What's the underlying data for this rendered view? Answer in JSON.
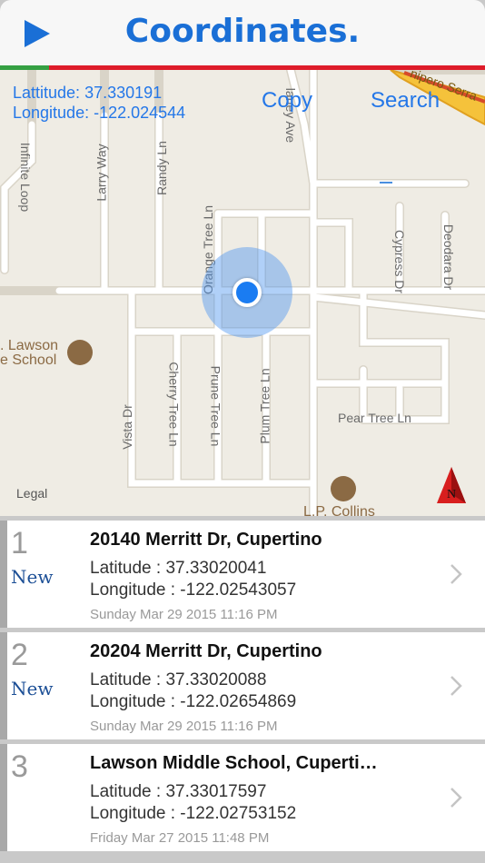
{
  "header": {
    "title": "Coordinates.",
    "play_icon": "play-icon",
    "accent_color": "#1a6fd6"
  },
  "map": {
    "coords": {
      "latitude_label": "Lattitude:",
      "latitude_value": "37.330191",
      "longitude_label": "Longitude:",
      "longitude_value": "-122.024544"
    },
    "copy_label": "Copy",
    "search_label": "Search",
    "legal_label": "Legal",
    "street_labels": {
      "infinite_loop": "Infinite Loop",
      "larry_way": "Larry Way",
      "randy_ln": "Randy Ln",
      "orange_tree_ln": "Orange Tree Ln",
      "cherry_tree_ln": "Cherry Tree Ln",
      "prune_tree_ln": "Prune Tree Ln",
      "plum_tree_ln": "Plum Tree Ln",
      "vista_dr": "Vista Dr",
      "cypress_dr": "Cypress Dr",
      "deodara_dr": "Deodara Dr",
      "pear_tree_ln": "Pear Tree Ln",
      "blaney_ave": "laney Ave",
      "junipero_serra": "nipero Serra",
      "infinite_loop_top": "Infinite Loo"
    },
    "poi_labels": {
      "lawson_line1": ". Lawson",
      "lawson_line2": "e School",
      "collins": "L.P. Collins"
    },
    "compass_label": "N"
  },
  "history": [
    {
      "index": "1",
      "badge": "New",
      "place": "20140 Merritt Dr, Cupertino",
      "latitude": "Latitude : 37.33020041",
      "longitude": "Longitude : -122.02543057",
      "timestamp": "Sunday Mar 29 2015 11:16 PM"
    },
    {
      "index": "2",
      "badge": "New",
      "place": "20204 Merritt Dr, Cupertino",
      "latitude": "Latitude : 37.33020088",
      "longitude": "Longitude : -122.02654869",
      "timestamp": "Sunday Mar 29 2015 11:16 PM"
    },
    {
      "index": "3",
      "badge": "",
      "place": "Lawson Middle School, Cuperti…",
      "latitude": "Latitude : 37.33017597",
      "longitude": "Longitude : -122.02753152",
      "timestamp": "Friday Mar 27 2015 11:48 PM"
    }
  ]
}
